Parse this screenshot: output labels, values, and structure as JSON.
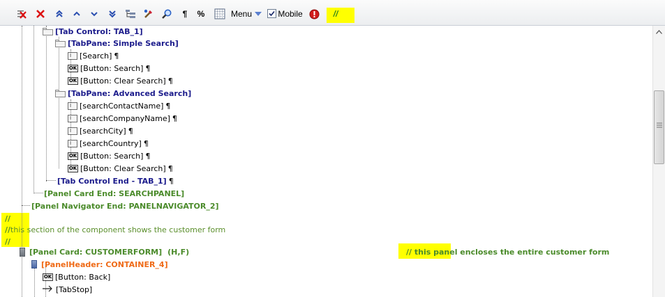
{
  "toolbar": {
    "menu_label": "Menu",
    "mobile_label": "Mobile",
    "mobile_checked": true,
    "pilcrow_glyph": "¶",
    "percent_glyph": "%",
    "comment_glyph": "//",
    "icons": [
      "delete-row-icon",
      "delete-icon",
      "move-top-icon",
      "move-up-icon",
      "move-down-icon",
      "move-bottom-icon",
      "insert-icon",
      "edit-icon",
      "search-icon",
      "pilcrow-icon",
      "percent-icon",
      "grid-icon",
      "dropdown-icon",
      "checkbox",
      "stop-icon",
      "comment-icon"
    ],
    "highlight_color": "#ffff00"
  },
  "tree": {
    "n1": "[Tab Control: TAB_1]",
    "n2": "[TabPane: Simple Search]",
    "n3": "[Search]",
    "n4": "[Button: Search]",
    "n5": "[Button: Clear Search]",
    "n6": "[TabPane: Advanced Search]",
    "n7": "[searchContactName]",
    "n8": "[searchCompanyName]",
    "n9": "[searchCity]",
    "n10": "[searchCountry]",
    "n11": "[Button: Search]",
    "n12": "[Button: Clear Search]",
    "n13": "[Tab Control End - TAB_1]",
    "n14": "[Panel Card End: SEARCHPANEL]",
    "n15": "[Panel Navigator End: PANELNAVIGATOR_2]",
    "c1": "//",
    "c2a": "//",
    "c2b": " this section of the component shows the customer form",
    "c3": "//",
    "n16": "[Panel Card: CUSTOMERFORM]",
    "n16_attr": "(H,F)",
    "n16_comment": "// this panel encloses the entire customer form",
    "n17": "[PanelHeader: CONTAINER_4]",
    "n18": "[Button: Back]",
    "n19": "[TabStop]",
    "pilcrow": "¶",
    "field_icon_text": "I",
    "ok_icon_text": "OK"
  },
  "colors": {
    "navy": "#1c1c8c",
    "green": "#4b8b2b",
    "orange": "#ef6a16",
    "highlight": "#ffff00"
  }
}
